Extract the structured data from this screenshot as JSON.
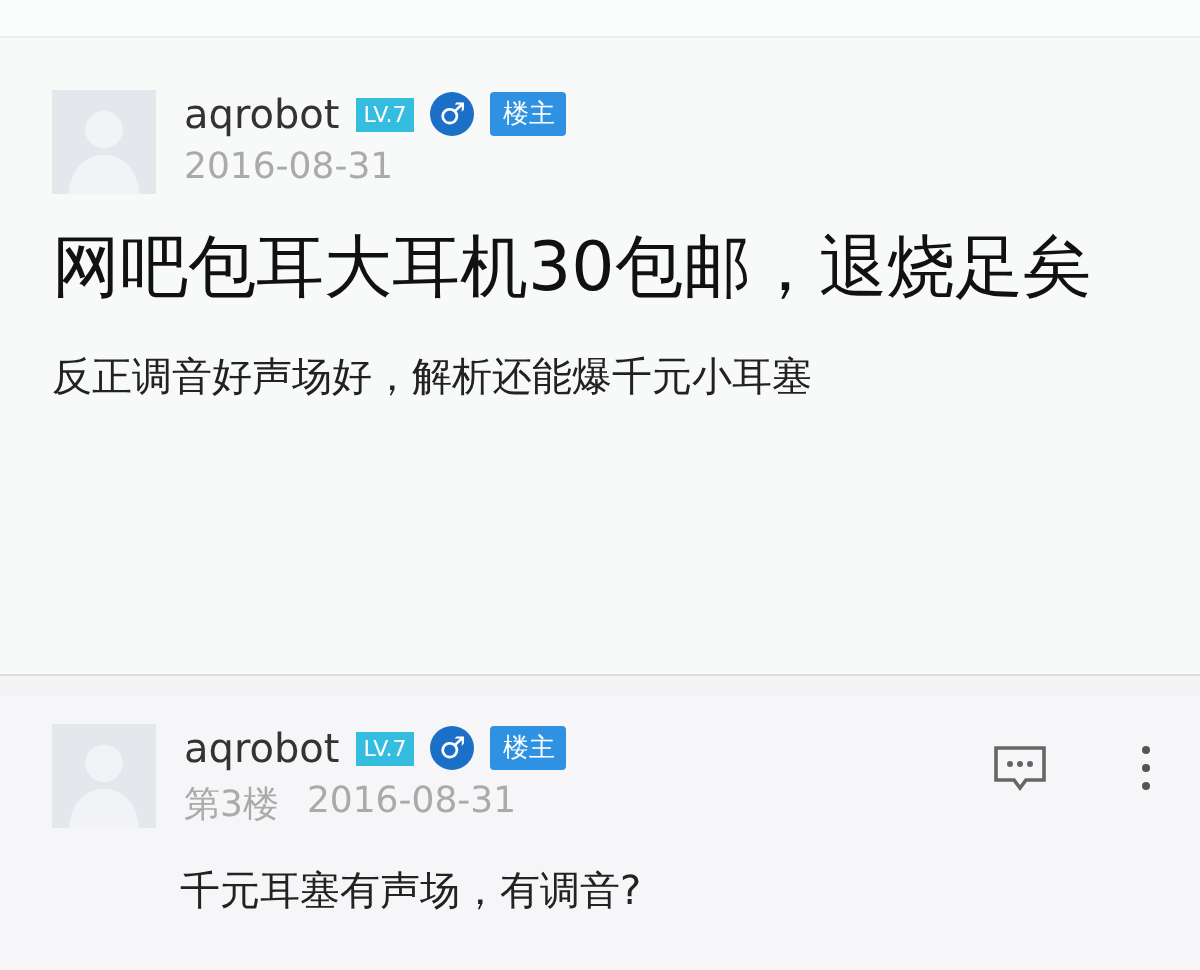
{
  "main_post": {
    "author": {
      "username": "aqrobot",
      "level": "LV.7",
      "gender": "♂",
      "op_badge": "楼主"
    },
    "date": "2016-08-31",
    "title": "网吧包耳大耳机30包邮，退烧足矣",
    "body": "反正调音好声场好，解析还能爆千元小耳塞"
  },
  "reply": {
    "author": {
      "username": "aqrobot",
      "level": "LV.7",
      "gender": "♂",
      "op_badge": "楼主"
    },
    "floor": "第3楼",
    "date": "2016-08-31",
    "text": "千元耳塞有声场，有调音?"
  }
}
